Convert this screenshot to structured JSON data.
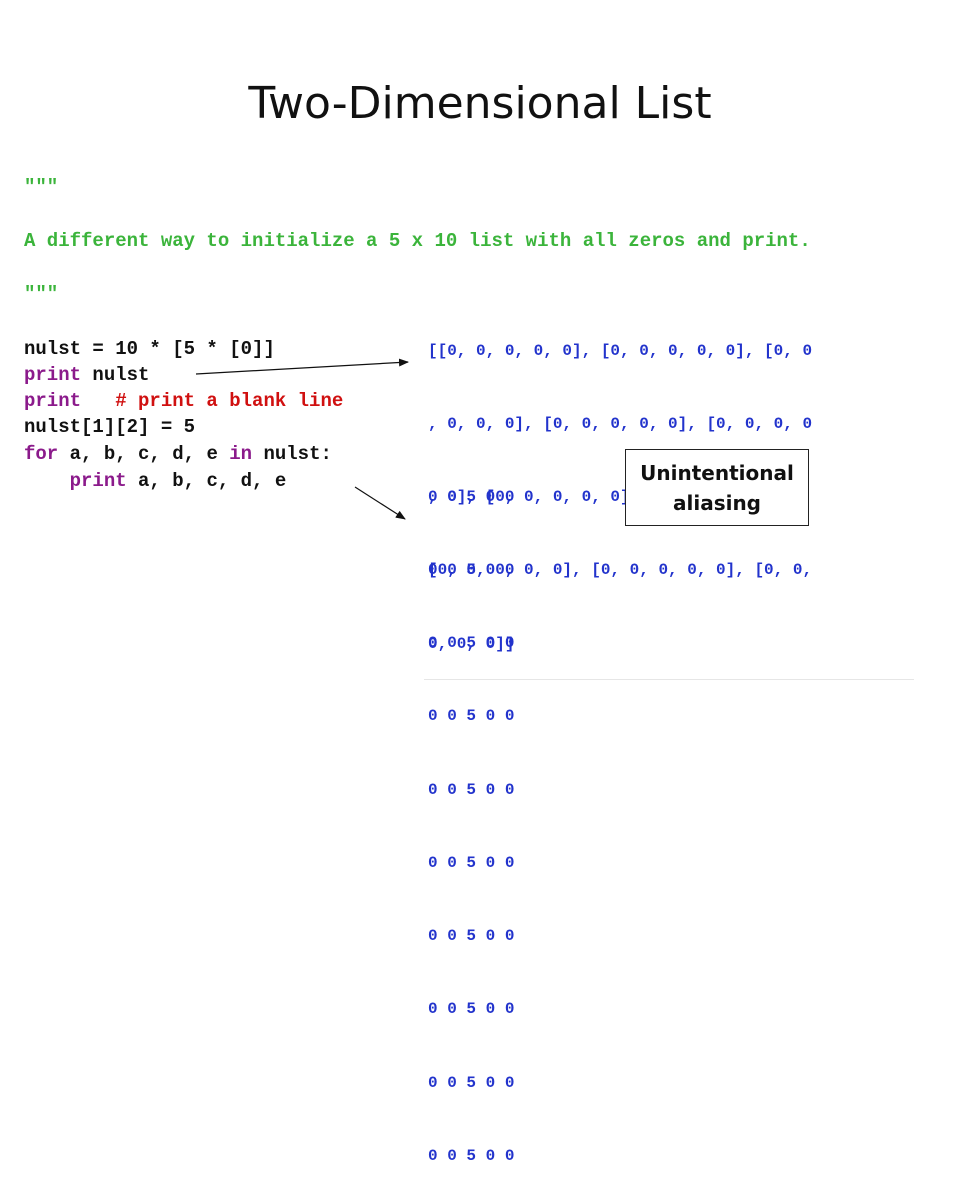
{
  "title": "Two-Dimensional List",
  "code": {
    "docstring_open": "\"\"\"",
    "docstring_text": "A different way to initialize a 5 x 10 list with all zeros and print.",
    "docstring_close": "\"\"\"",
    "line1": "nulst = 10 * [5 * [0]]",
    "line2_kw": "print",
    "line2_rest": " nulst",
    "line3_kw": "print",
    "line3_comment": "   # print a blank line",
    "line4": "nulst[1][2] = 5",
    "line5_for": "for",
    "line5_mid": " a, b, c, d, e ",
    "line5_in": "in",
    "line5_end": " nulst:",
    "line6_indent": "    ",
    "line6_kw": "print",
    "line6_rest": " a, b, c, d, e"
  },
  "output": {
    "list_lines": [
      "[[0, 0, 0, 0, 0], [0, 0, 0, 0, 0], [0, 0",
      ", 0, 0, 0], [0, 0, 0, 0, 0], [0, 0, 0, 0",
      ", 0], [0, 0, 0, 0, 0], [0, 0, 0, 0, 0],",
      "[0, 0, 0, 0, 0], [0, 0, 0, 0, 0], [0, 0,",
      "0, 0, 0]]"
    ],
    "rows": [
      "0 0 5 0 0",
      "0 0 5 0 0",
      "0 0 5 0 0",
      "0 0 5 0 0",
      "0 0 5 0 0",
      "0 0 5 0 0",
      "0 0 5 0 0",
      "0 0 5 0 0",
      "0 0 5 0 0",
      "0 0 5 0 0"
    ]
  },
  "callout": {
    "line1": "Unintentional",
    "line2": "aliasing"
  },
  "colors": {
    "string": "#3bb43b",
    "keyword": "#8b1a8b",
    "comment": "#d01010",
    "output": "#2233cc"
  }
}
